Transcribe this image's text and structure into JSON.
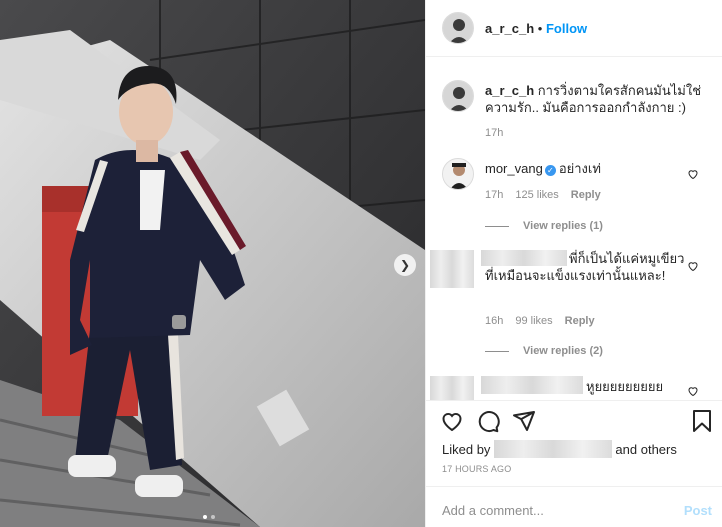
{
  "post": {
    "username": "a_r_c_h",
    "bullet": "•",
    "follow_label": "Follow",
    "caption": "การวิ่งตามใครสักคนมันไม่ใช่ความรัก.. มันคือการออกกำลังกาย :)",
    "caption_time": "17h"
  },
  "comments": [
    {
      "username": "mor_vang",
      "verified": true,
      "text": "อย่างเท่",
      "time": "17h",
      "likes": "125 likes",
      "reply_label": "Reply",
      "view_replies": "View replies (1)"
    },
    {
      "username": "",
      "text": "พี่ก็เป็นได้แค่หมูเขียวที่เหมือนจะแข็งแรงเท่านั้นแหละ!",
      "time": "16h",
      "likes": "99 likes",
      "reply_label": "Reply",
      "view_replies": "View replies (2)"
    },
    {
      "username": "",
      "text": "หูยยยยยยยยย"
    }
  ],
  "actions": {
    "liked_prefix": "Liked by",
    "liked_suffix": "and others",
    "time_ago": "17 HOURS AGO",
    "comment_placeholder": "Add a comment...",
    "post_label": "Post"
  },
  "icons": {
    "like": "heart-icon",
    "comment": "comment-icon",
    "share": "share-icon",
    "save": "bookmark-icon",
    "next": "chevron-right-icon",
    "verified": "verified-badge-icon"
  },
  "colors": {
    "accent": "#0095f6",
    "verified": "#3897f0",
    "muted": "#8e8e8e",
    "post_disabled": "#b2dffc"
  },
  "carousel": {
    "slide_count": 2,
    "active_slide": 1
  }
}
